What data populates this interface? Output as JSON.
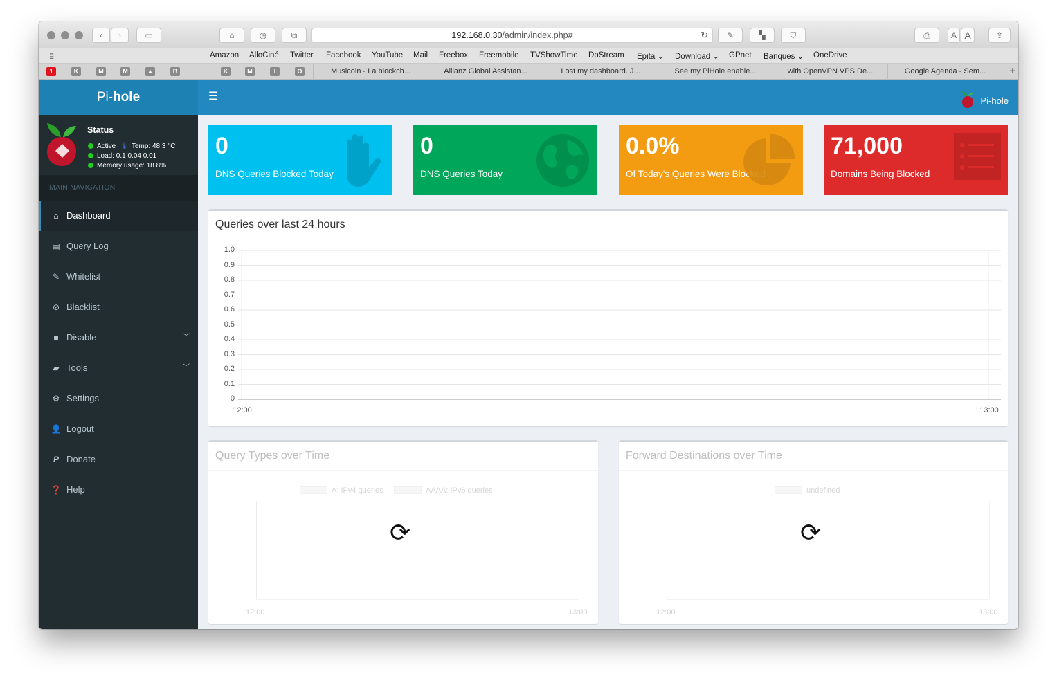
{
  "browser": {
    "url_host": "192.168.0.30",
    "url_path": "/admin/index.php#",
    "favorites": [
      {
        "label": "Amazon"
      },
      {
        "label": "AlloCiné"
      },
      {
        "label": "Twitter"
      },
      {
        "label": "Facebook"
      },
      {
        "label": "YouTube"
      },
      {
        "label": "Mail"
      },
      {
        "label": "Freebox"
      },
      {
        "label": "Freemobile"
      },
      {
        "label": "TVShowTime"
      },
      {
        "label": "DpStream"
      },
      {
        "label": "Epita ⌄"
      },
      {
        "label": "Download ⌄"
      },
      {
        "label": "GPnet"
      },
      {
        "label": "Banques ⌄"
      },
      {
        "label": "OneDrive"
      }
    ],
    "pinned": [
      "1",
      "K",
      "M",
      "M",
      "",
      "B",
      "K",
      "M",
      "I",
      "O"
    ],
    "tabs": [
      {
        "label": "Musicoin - La blockch..."
      },
      {
        "label": "Allianz Global Assistan..."
      },
      {
        "label": "Lost my dashboard. J..."
      },
      {
        "label": "See my PiHole enable..."
      },
      {
        "label": "with OpenVPN VPS De..."
      },
      {
        "label": "Google Agenda - Sem..."
      }
    ]
  },
  "sidebar": {
    "brand_prefix": "Pi-",
    "brand_suffix": "hole",
    "status_title": "Status",
    "status_active": "Active",
    "temp": "Temp: 48.3 °C",
    "load": "Load:  0.1  0.04  0.01",
    "memory": "Memory usage:  18.8%",
    "nav_header": "MAIN NAVIGATION",
    "items": [
      {
        "label": "Dashboard",
        "icon": "home-icon"
      },
      {
        "label": "Query Log",
        "icon": "file-icon"
      },
      {
        "label": "Whitelist",
        "icon": "edit-icon"
      },
      {
        "label": "Blacklist",
        "icon": "ban-icon"
      },
      {
        "label": "Disable",
        "icon": "stop-icon"
      },
      {
        "label": "Tools",
        "icon": "folder-icon"
      },
      {
        "label": "Settings",
        "icon": "gears-icon"
      },
      {
        "label": "Logout",
        "icon": "user-times-icon"
      },
      {
        "label": "Donate",
        "icon": "paypal-icon"
      },
      {
        "label": "Help",
        "icon": "question-icon"
      }
    ]
  },
  "header": {
    "brand": "Pi-hole"
  },
  "stats": [
    {
      "value": "0",
      "label": "DNS Queries Blocked Today",
      "color": "#00c0ef",
      "icon": "hand-icon"
    },
    {
      "value": "0",
      "label": "DNS Queries Today",
      "color": "#00a65a",
      "icon": "globe-icon"
    },
    {
      "value": "0.0%",
      "label": "Of Today's Queries Were Blocked",
      "color": "#f39c12",
      "icon": "pie-chart-icon"
    },
    {
      "value": "71,000",
      "label": "Domains Being Blocked",
      "color": "#dd2a2a",
      "icon": "list-icon"
    }
  ],
  "queries_chart": {
    "title": "Queries over last 24 hours"
  },
  "query_types": {
    "title": "Query Types over Time",
    "legend": [
      "A: IPv4 queries",
      "AAAA: IPv6 queries"
    ],
    "x_ticks": [
      "12:00",
      "13:00"
    ]
  },
  "forward_destinations": {
    "title": "Forward Destinations over Time",
    "legend": [
      "undefined"
    ],
    "x_ticks": [
      "12:00",
      "13:00"
    ]
  },
  "chart_data": {
    "type": "line",
    "x": [
      "12:00",
      "13:00"
    ],
    "y_ticks": [
      "1.0",
      "0.9",
      "0.8",
      "0.7",
      "0.6",
      "0.5",
      "0.4",
      "0.3",
      "0.2",
      "0.1",
      "0"
    ],
    "ylim": [
      0,
      1.0
    ],
    "series": [],
    "grid": true
  },
  "colors": {
    "sidebar": "#222d32",
    "header": "#2488c0",
    "logo_bar": "#1e81b3",
    "accent": "#3c8dbc"
  }
}
